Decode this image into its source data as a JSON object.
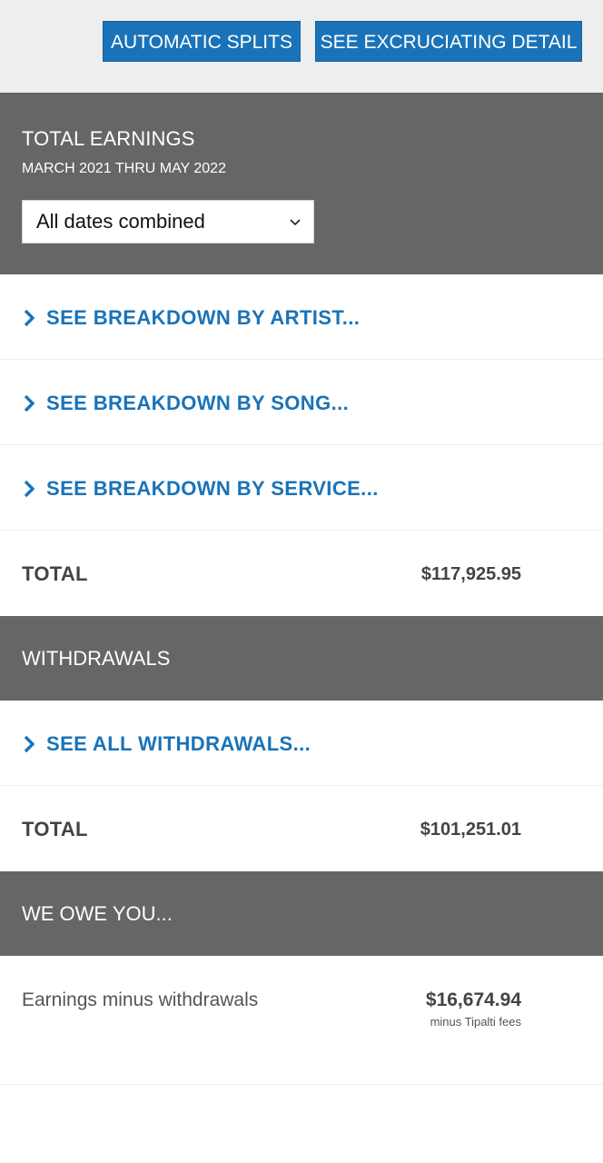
{
  "topbar": {
    "automatic_splits_label": "AUTOMATIC SPLITS",
    "excruciating_detail_label": "SEE EXCRUCIATING DETAIL"
  },
  "earnings": {
    "title": "TOTAL EARNINGS",
    "date_range": "MARCH 2021 THRU MAY 2022",
    "date_select_value": "All dates combined",
    "links": [
      {
        "label": "SEE BREAKDOWN BY ARTIST..."
      },
      {
        "label": "SEE BREAKDOWN BY SONG..."
      },
      {
        "label": "SEE BREAKDOWN BY SERVICE..."
      }
    ],
    "total_label": "TOTAL",
    "total_value": "$117,925.95"
  },
  "withdrawals": {
    "title": "WITHDRAWALS",
    "link_label": "SEE ALL WITHDRAWALS...",
    "total_label": "TOTAL",
    "total_value": "$101,251.01"
  },
  "owe": {
    "title": "WE OWE YOU...",
    "row_label": "Earnings minus withdrawals",
    "row_value": "$16,674.94",
    "row_note": "minus Tipalti fees"
  },
  "colors": {
    "accent": "#1a73b8",
    "header_bg": "#666666",
    "topbar_bg": "#eeeeee"
  },
  "icons": {
    "dropdown": "chevron-down-icon",
    "link": "chevron-right-icon"
  }
}
